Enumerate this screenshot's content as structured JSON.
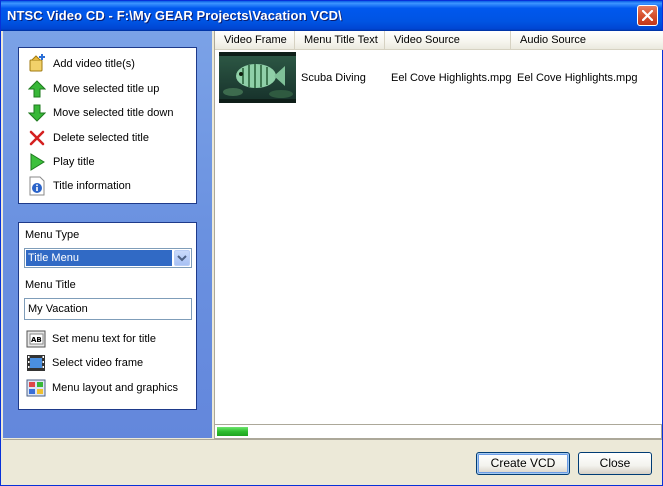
{
  "window": {
    "title": "NTSC Video CD - F:\\My GEAR Projects\\Vacation VCD\\"
  },
  "tasks": [
    {
      "label": "Add video title(s)",
      "icon": "add-video-icon"
    },
    {
      "label": "Move selected title up",
      "icon": "arrow-up-icon"
    },
    {
      "label": "Move selected title down",
      "icon": "arrow-down-icon"
    },
    {
      "label": "Delete selected title",
      "icon": "delete-x-icon"
    },
    {
      "label": "Play title",
      "icon": "play-icon"
    },
    {
      "label": "Title information",
      "icon": "info-icon"
    }
  ],
  "menu": {
    "type_label": "Menu Type",
    "type_value": "Title Menu",
    "title_label": "Menu Title",
    "title_value": "My Vacation",
    "actions": [
      {
        "label": "Set menu text for title",
        "icon": "menu-text-icon"
      },
      {
        "label": "Select video frame",
        "icon": "film-frame-icon"
      },
      {
        "label": "Menu layout and graphics",
        "icon": "layout-graphics-icon"
      }
    ]
  },
  "list": {
    "columns": [
      "Video Frame",
      "Menu Title Text",
      "Video Source",
      "Audio Source"
    ],
    "rows": [
      {
        "menu_title": "Scuba Diving",
        "video_source": "Eel Cove Highlights.mpg",
        "audio_source": "Eel Cove Highlights.mpg"
      }
    ]
  },
  "progress": {
    "value_percent": 7
  },
  "buttons": {
    "create": "Create VCD",
    "close": "Close"
  },
  "colors": {
    "titlebar": "#0054E3",
    "taskpane": "#6A91E0",
    "progress": "#2EBD2E",
    "selection": "#316AC5"
  }
}
